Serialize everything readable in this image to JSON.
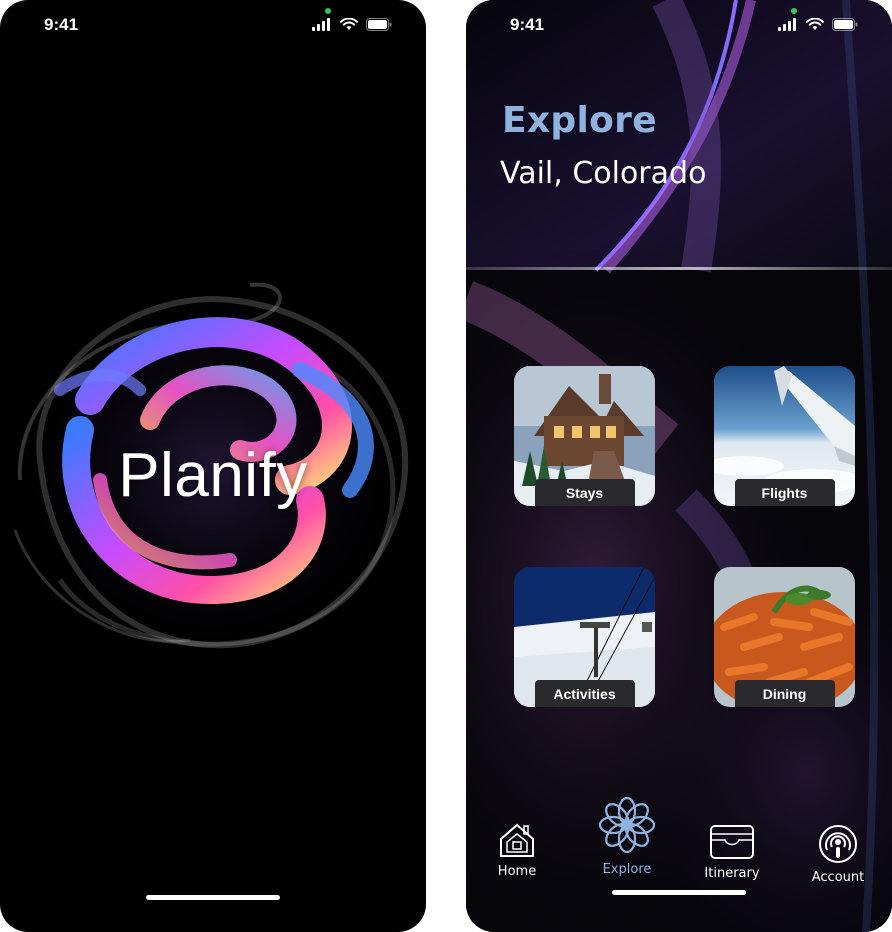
{
  "splash": {
    "status_time": "9:41",
    "title": "Planify"
  },
  "explore": {
    "status_time": "9:41",
    "heading": "Explore",
    "location": "Vail, Colorado",
    "categories": [
      {
        "label": "Stays",
        "icon": "lodge-photo"
      },
      {
        "label": "Flights",
        "icon": "airplane-wing-photo"
      },
      {
        "label": "Activities",
        "icon": "ski-lift-photo"
      },
      {
        "label": "Dining",
        "icon": "pasta-photo"
      }
    ],
    "tabs": [
      {
        "label": "Home",
        "icon": "home-icon"
      },
      {
        "label": "Explore",
        "icon": "flower-icon",
        "active": true
      },
      {
        "label": "Itinerary",
        "icon": "wallet-icon"
      },
      {
        "label": "Account",
        "icon": "podcast-person-icon"
      }
    ]
  },
  "colors": {
    "accent": "#8fb3de",
    "background": "#000000",
    "status_dot": "#34c759"
  }
}
